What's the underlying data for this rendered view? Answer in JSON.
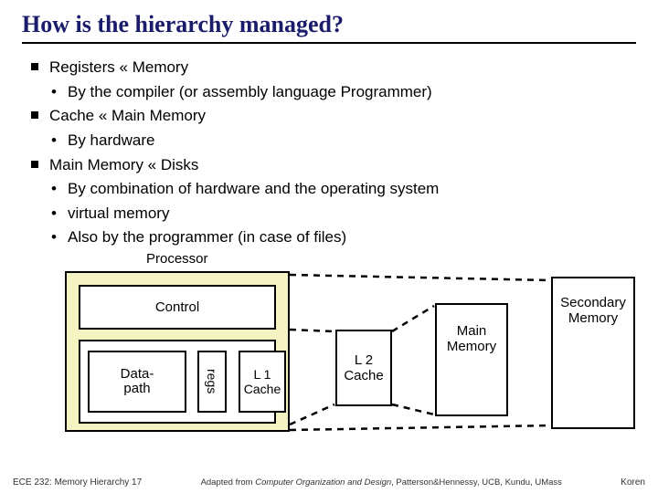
{
  "title": "How is the hierarchy managed?",
  "bullets": {
    "b1a": "Registers  «  Memory",
    "b1a_sub1": "By the compiler (or assembly language Programmer)",
    "b1b": "Cache  «  Main Memory",
    "b1b_sub1": "By hardware",
    "b1c": "Main Memory « Disks",
    "b1c_sub1": "By combination of hardware and the operating system",
    "b1c_sub2": "virtual memory",
    "b1c_sub3": "Also by the programmer (in case of files)"
  },
  "diagram": {
    "processor": "Processor",
    "control": "Control",
    "datapath": "Data-\npath",
    "regs": "regs",
    "l1": "L 1\nCache",
    "l2": "L 2\nCache",
    "mainmem": "Main\nMemory",
    "secondary": "Secondary\nMemory"
  },
  "footer": {
    "left": "ECE 232: Memory Hierarchy 17",
    "mid_pre": "Adapted from ",
    "mid_ital": "Computer Organization and Design",
    "mid_post": ", Patterson&Hennessy, UCB, Kundu, UMass",
    "right": "Koren"
  }
}
